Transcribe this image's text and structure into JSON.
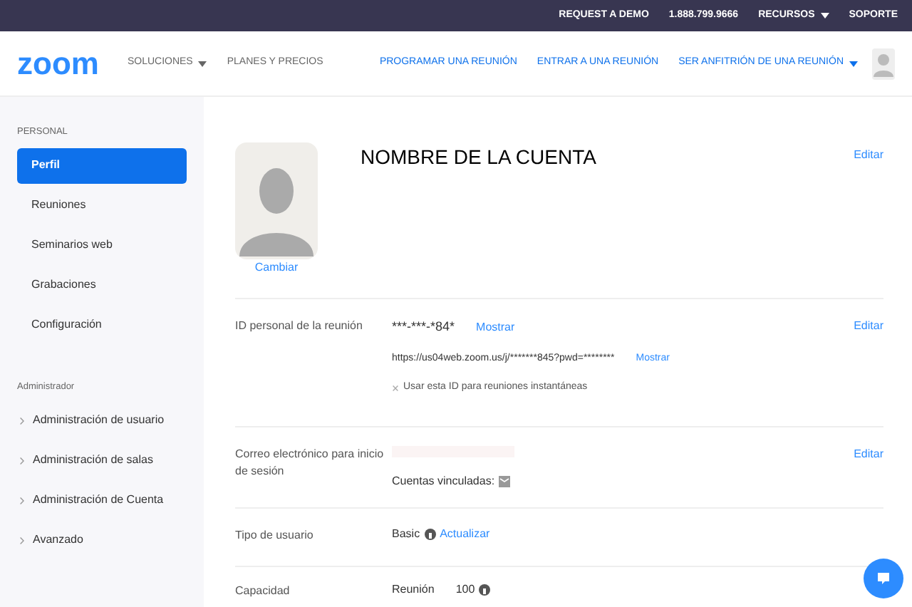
{
  "top_bar": {
    "links": [
      {
        "label": "REQUEST A DEMO",
        "has_caret": false
      },
      {
        "label": "1.888.799.9666",
        "has_caret": false
      },
      {
        "label": "RECURSOS",
        "has_caret": true
      },
      {
        "label": "SOPORTE",
        "has_caret": false
      }
    ]
  },
  "nav": {
    "logo": "zoom",
    "left_links": [
      {
        "label": "SOLUCIONES",
        "has_caret": true
      },
      {
        "label": "PLANES Y PRECIOS",
        "has_caret": false
      }
    ],
    "right_links": [
      {
        "label": "PROGRAMAR UNA REUNIÓN",
        "has_caret": false
      },
      {
        "label": "ENTRAR A UNA REUNIÓN",
        "has_caret": false
      },
      {
        "label": "SER ANFITRIÓN DE UNA REUNIÓN",
        "has_caret": true
      }
    ]
  },
  "sidebar": {
    "sections": [
      {
        "title": "PERSONAL",
        "items": [
          {
            "label": "Perfil",
            "selected": true,
            "expandable": false
          },
          {
            "label": "Reuniones",
            "selected": false,
            "expandable": false
          },
          {
            "label": "Seminarios web",
            "selected": false,
            "expandable": false
          },
          {
            "label": "Grabaciones",
            "selected": false,
            "expandable": false
          },
          {
            "label": "Configuración",
            "selected": false,
            "expandable": false
          }
        ]
      },
      {
        "title": "Administrador",
        "items": [
          {
            "label": "Administración de usuario",
            "selected": false,
            "expandable": true
          },
          {
            "label": "Administración de salas",
            "selected": false,
            "expandable": true
          },
          {
            "label": "Administración de Cuenta",
            "selected": false,
            "expandable": true
          },
          {
            "label": "Avanzado",
            "selected": false,
            "expandable": true
          }
        ]
      }
    ]
  },
  "profile": {
    "change_link": "Cambiar",
    "account_name": "NOMBRE DE LA CUENTA",
    "edit": "Editar"
  },
  "meeting_id": {
    "label": "ID personal de la reunión",
    "id": "***-***-*84*",
    "show": "Mostrar",
    "url": "https://us04web.zoom.us/j/*******845?pwd=********",
    "url_show": "Mostrar",
    "instant_option": {
      "label": "Usar esta ID para reuniones instantáneas",
      "checked": false
    },
    "edit": "Editar"
  },
  "email": {
    "label": "Correo electrónico para inicio de sesión",
    "linked_accounts": "Cuentas vinculadas:",
    "edit": "Editar"
  },
  "user_type": {
    "label": "Tipo de usuario",
    "value": "Basic",
    "upgrade": "Actualizar"
  },
  "capacity": {
    "label": "Capacidad",
    "kind": "Reunión",
    "value": "100"
  }
}
